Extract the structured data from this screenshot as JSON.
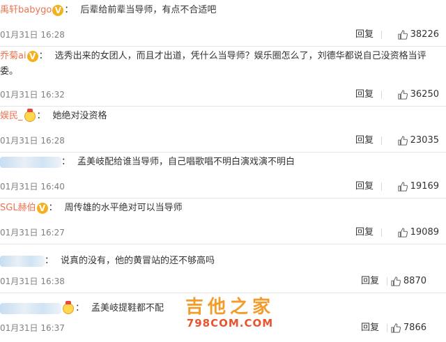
{
  "comments": [
    {
      "user": "禹轩babygo",
      "badge": "v",
      "text": "后辈给前辈当导师，有点不合适吧",
      "time": "01月31日 16:28",
      "reply": "回复",
      "likes": "38226"
    },
    {
      "user": "乔菊ai",
      "badge": "v",
      "text": "选秀出来的女团人，而且才出道，凭什么当导师？娱乐圈怎么了，刘德华都说自己没资格当评委。",
      "time": "01月31日 16:32",
      "reply": "回复",
      "likes": "36250"
    },
    {
      "user": "娱民_",
      "badge": "crown",
      "text": "她绝对没资格",
      "time": "01月31日 16:28",
      "reply": "回复",
      "likes": "23035"
    },
    {
      "user": "",
      "badge": "",
      "text": "孟美岐配给谁当导师，自己唱歌唱不明白演戏演不明白",
      "time": "01月31日 16:40",
      "reply": "回复",
      "likes": "19169"
    },
    {
      "user": "SGL赫伯",
      "badge": "v",
      "text": "周传雄的水平绝对可以当导师",
      "time": "01月31日 16:27",
      "reply": "回复",
      "likes": "19089"
    },
    {
      "user": "",
      "badge": "",
      "text": "说真的没有，他的黄冒站的还不够高吗",
      "time": "01月31日 16:38",
      "reply": "回复",
      "likes": "8870"
    },
    {
      "user": "",
      "badge": "crown",
      "text": "孟美岐提鞋都不配",
      "time": "01月31日 16:37",
      "reply": "回复",
      "likes": "7866"
    }
  ],
  "watermark": {
    "title": "吉他之家",
    "url": "798COM.COM"
  },
  "colors": {
    "username": "#eb7350",
    "time": "#808080",
    "badge": "#f4b01d"
  }
}
